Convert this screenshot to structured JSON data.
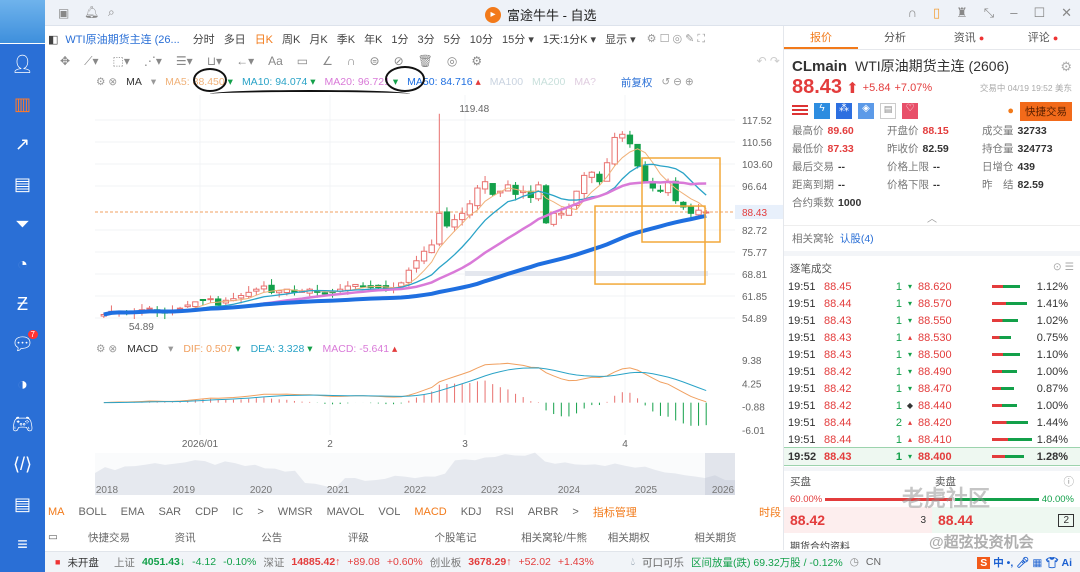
{
  "window": {
    "title": "富途牛牛 - 自选"
  },
  "sidebar": {
    "items": [
      "user",
      "chart",
      "trend",
      "stats",
      "filter",
      "pie",
      "swap",
      "chat",
      "clock",
      "game",
      "code",
      "doc",
      "menu"
    ],
    "chat_badge": "7"
  },
  "toolbar": {
    "symbol": "WTI原油期货主连 (26...",
    "periods": [
      "分时",
      "多日",
      "日K",
      "周K",
      "月K",
      "季K",
      "年K",
      "1分",
      "3分",
      "5分",
      "10分",
      "15分 ▾",
      "1天:1分K ▾",
      "显示 ▾"
    ],
    "selected": "日K"
  },
  "ma_legend": {
    "name": "MA",
    "ma5_label": "MA5:",
    "ma5": "88.450",
    "ma10_label": "MA10:",
    "ma10": "94.074",
    "ma20_label": "MA20:",
    "ma20": "96.721",
    "ma50_label": "MA50:",
    "ma50": "84.716",
    "faded": [
      "MA100",
      "MA200",
      "MA?"
    ],
    "adjust": "前复权"
  },
  "chart_data": {
    "type": "candlestick",
    "y_ticks": [
      "117.52",
      "110.56",
      "103.60",
      "96.64",
      "88.43",
      "82.72",
      "75.77",
      "68.81",
      "61.85",
      "54.89"
    ],
    "ylim": [
      54.89,
      117.52
    ],
    "high_label": "119.48",
    "low_label": "54.89",
    "last_price": "88.43",
    "x_ticks": [
      "2026/01",
      "2",
      "3",
      "4"
    ],
    "closes": [
      56,
      57,
      57,
      56.5,
      57,
      57.5,
      58,
      57,
      56.5,
      57,
      58,
      59,
      60,
      60.5,
      61,
      59,
      60.5,
      61,
      62,
      63,
      64,
      65,
      63,
      63.5,
      64,
      63,
      63.5,
      64,
      63,
      62.5,
      63,
      64,
      65,
      65.5,
      65,
      64.5,
      64.5,
      64,
      64.5,
      66,
      70,
      73,
      76,
      78,
      88,
      84,
      86,
      88,
      91,
      96,
      98,
      94,
      95,
      97,
      94,
      95,
      93,
      97,
      85,
      88,
      88,
      90,
      95,
      100,
      101,
      98,
      104,
      112,
      113,
      110,
      103,
      98,
      96,
      95,
      98,
      92,
      90,
      88,
      89,
      88.43
    ],
    "macd": {
      "name": "MACD",
      "dif_label": "DIF:",
      "dif": "0.507",
      "dea_label": "DEA:",
      "dea": "3.328",
      "macd_label": "MACD:",
      "macd": "-5.641",
      "y_ticks": [
        "9.38",
        "4.25",
        "-0.88",
        "-6.01"
      ],
      "ylim": [
        -6.01,
        9.38
      ]
    },
    "navigator_years": [
      "2018",
      "2019",
      "2020",
      "2021",
      "2022",
      "2023",
      "2024",
      "2025",
      "2026"
    ]
  },
  "indicators": {
    "items": [
      "MA",
      "BOLL",
      "EMA",
      "SAR",
      "CDP",
      "IC",
      ">",
      "WMSR",
      "MAVOL",
      "VOL",
      "MACD",
      "KDJ",
      "RSI",
      "ARBR",
      ">"
    ],
    "manage": "指标管理",
    "period": "时段"
  },
  "links": [
    "快捷交易",
    "资讯",
    "公告",
    "评级",
    "个股笔记",
    "相关窝轮/牛熊",
    "相关期权",
    "相关期货"
  ],
  "status": {
    "market": "未开盘",
    "sh_label": "上证",
    "sh": "4051.43↓",
    "sh_chg": "-4.12",
    "sh_pct": "-0.10%",
    "sz_label": "深证",
    "sz": "14885.42↑",
    "sz_chg": "+89.08",
    "sz_pct": "+0.60%",
    "cy_label": "创业板",
    "cy": "3678.29↑",
    "cy_chg": "+52.02",
    "cy_pct": "+1.43%",
    "stock": "可口可乐",
    "volume": "区间放量(跌) 69.32万股 / -0.12%",
    "cn": "CN"
  },
  "right": {
    "tabs": [
      "报价",
      "分析",
      "资讯",
      "评论"
    ],
    "code": "CLmain",
    "name": "WTI原油期货主连 (2606)",
    "price": "88.43",
    "change": "+5.84",
    "change_pct": "+7.07%",
    "status": "交易中 04/19 19:52 美东",
    "quick_trade": "快捷交易",
    "quotes": [
      [
        "最高价",
        "89.60"
      ],
      [
        "开盘价",
        "88.15"
      ],
      [
        "成交量",
        "32733"
      ],
      [
        "最低价",
        "87.33"
      ],
      [
        "昨收价",
        "82.59"
      ],
      [
        "持仓量",
        "324773"
      ],
      [
        "最后交易",
        "--"
      ],
      [
        "价格上限",
        "--"
      ],
      [
        "日增仓",
        "439"
      ],
      [
        "距离到期",
        "--"
      ],
      [
        "价格下限",
        "--"
      ],
      [
        "昨　结",
        "82.59"
      ],
      [
        "合约乘数",
        "1000"
      ]
    ],
    "related_label": "相关窝轮",
    "related_link": "认股(4)",
    "ticks_title": "逐笔成交",
    "ticks": [
      [
        "19:51",
        "88.45",
        "1",
        "▾",
        "88.620",
        "1.12%"
      ],
      [
        "19:51",
        "88.44",
        "1",
        "▾",
        "88.570",
        "1.41%"
      ],
      [
        "19:51",
        "88.43",
        "1",
        "▾",
        "88.550",
        "1.02%"
      ],
      [
        "19:51",
        "88.43",
        "1",
        "▴",
        "88.530",
        "0.75%"
      ],
      [
        "19:51",
        "88.43",
        "1",
        "▾",
        "88.500",
        "1.10%"
      ],
      [
        "19:51",
        "88.42",
        "1",
        "▾",
        "88.490",
        "1.00%"
      ],
      [
        "19:51",
        "88.42",
        "1",
        "▾",
        "88.470",
        "0.87%"
      ],
      [
        "19:51",
        "88.42",
        "1",
        "◆",
        "88.440",
        "1.00%"
      ],
      [
        "19:51",
        "88.44",
        "2",
        "▴",
        "88.420",
        "1.44%"
      ],
      [
        "19:51",
        "88.44",
        "1",
        "▴",
        "88.410",
        "1.84%"
      ],
      [
        "19:52",
        "88.43",
        "1",
        "▾",
        "88.400",
        "1.28%"
      ]
    ],
    "bid_label": "买盘",
    "ask_label": "卖盘",
    "bid_pct": "60.00%",
    "ask_pct": "40.00%",
    "bid": "88.42",
    "bid_size": "3",
    "ask": "88.44",
    "ask_size": "2",
    "more": "期货合约资料",
    "watermark1": "老虎社区",
    "watermark2": "@超弦投资机会"
  },
  "colors": {
    "accent": "#f27a1a",
    "up": "#e33c3c",
    "down": "#13a04a",
    "sidebar": "#2a6fd6",
    "ma5": "#f0b27a",
    "ma10": "#2aa3c7",
    "ma20": "#d97ad8",
    "ma50": "#1f6fe0"
  }
}
